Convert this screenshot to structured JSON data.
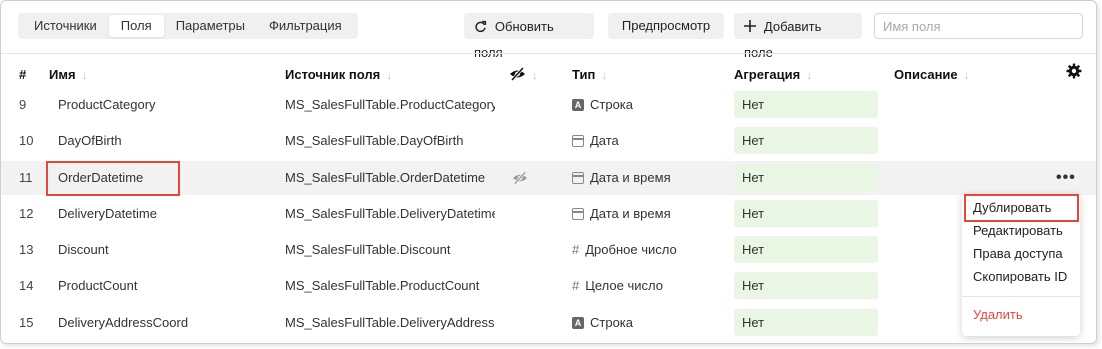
{
  "tabs": [
    {
      "label": "Источники",
      "active": false
    },
    {
      "label": "Поля",
      "active": true
    },
    {
      "label": "Параметры",
      "active": false
    },
    {
      "label": "Фильтрация",
      "active": false
    }
  ],
  "toolbar": {
    "refresh_label": "Обновить поля",
    "preview_label": "Предпросмотр",
    "add_field_label": "Добавить поле",
    "search_placeholder": "Имя поля",
    "search_value": ""
  },
  "columns": {
    "num": "#",
    "name": "Имя",
    "source": "Источник поля",
    "type": "Тип",
    "aggregation": "Агрегация",
    "description": "Описание"
  },
  "rows": [
    {
      "num": "9",
      "name": "ProductCategory",
      "source": "MS_SalesFullTable.ProductCategory",
      "type": "Строка",
      "type_icon": "string-icon",
      "aggregation": "Нет",
      "hidden_icon": false
    },
    {
      "num": "10",
      "name": "DayOfBirth",
      "source": "MS_SalesFullTable.DayOfBirth",
      "type": "Дата",
      "type_icon": "date-icon",
      "aggregation": "Нет",
      "hidden_icon": false
    },
    {
      "num": "11",
      "name": "OrderDatetime",
      "source": "MS_SalesFullTable.OrderDatetime",
      "type": "Дата и время",
      "type_icon": "datetime-icon",
      "aggregation": "Нет",
      "hidden_icon": true
    },
    {
      "num": "12",
      "name": "DeliveryDatetime",
      "source": "MS_SalesFullTable.DeliveryDatetime",
      "type": "Дата и время",
      "type_icon": "datetime-icon",
      "aggregation": "Нет",
      "hidden_icon": false
    },
    {
      "num": "13",
      "name": "Discount",
      "source": "MS_SalesFullTable.Discount",
      "type": "Дробное число",
      "type_icon": "hash-icon",
      "aggregation": "Нет",
      "hidden_icon": false
    },
    {
      "num": "14",
      "name": "ProductCount",
      "source": "MS_SalesFullTable.ProductCount",
      "type": "Целое число",
      "type_icon": "hash-icon",
      "aggregation": "Нет",
      "hidden_icon": false
    },
    {
      "num": "15",
      "name": "DeliveryAddressCoord",
      "source": "MS_SalesFullTable.DeliveryAddressCoord",
      "type": "Строка",
      "type_icon": "string-icon",
      "aggregation": "Нет",
      "hidden_icon": false
    }
  ],
  "context_menu": {
    "items": [
      "Дублировать",
      "Редактировать",
      "Права доступа",
      "Скопировать ID"
    ],
    "danger_item": "Удалить"
  },
  "colors": {
    "aggregation_bg": "#e9f6e4",
    "highlight_row": "#f2f2f2",
    "annotation_red": "#e6473a",
    "danger": "#e6473a"
  }
}
